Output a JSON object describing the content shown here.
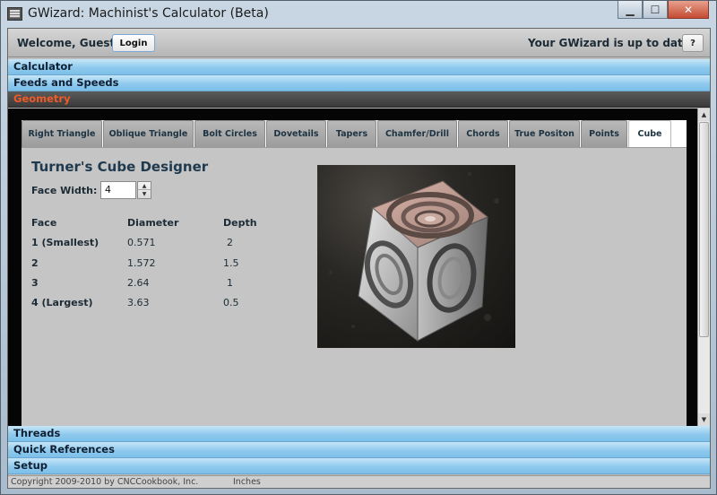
{
  "window": {
    "title": "GWizard: Machinist's Calculator (Beta)",
    "minimize_glyph": "▁",
    "maximize_glyph": "☐",
    "close_glyph": "✕"
  },
  "topbar": {
    "welcome": "Welcome, Guest!",
    "login_label": "Login",
    "status": "Your GWizard is up to date",
    "help_label": "?"
  },
  "sections": {
    "calculator": "Calculator",
    "feeds_speeds": "Feeds and Speeds",
    "geometry": "Geometry",
    "threads": "Threads",
    "quick_references": "Quick References",
    "setup": "Setup"
  },
  "tabs": [
    {
      "label": "Right Triangle",
      "active": false
    },
    {
      "label": "Oblique Triangle",
      "active": false
    },
    {
      "label": "Bolt Circles",
      "active": false
    },
    {
      "label": "Dovetails",
      "active": false
    },
    {
      "label": "Tapers",
      "active": false
    },
    {
      "label": "Chamfer/Drill",
      "active": false
    },
    {
      "label": "Chords",
      "active": false
    },
    {
      "label": "True Positon",
      "active": false
    },
    {
      "label": "Points",
      "active": false
    },
    {
      "label": "Cube",
      "active": true
    }
  ],
  "cube": {
    "title": "Turner's Cube Designer",
    "face_width_label": "Face Width:",
    "face_width_value": "4",
    "columns": [
      "Face",
      "Diameter",
      "Depth"
    ],
    "rows": [
      {
        "face": "1 (Smallest)",
        "diameter": "0.571",
        "depth": "2"
      },
      {
        "face": "2",
        "diameter": "1.572",
        "depth": "1.5"
      },
      {
        "face": "3",
        "diameter": "2.64",
        "depth": "1"
      },
      {
        "face": "4 (Largest)",
        "diameter": "3.63",
        "depth": "0.5"
      }
    ]
  },
  "footer": {
    "copyright": "Copyright 2009-2010 by CNCCookbook, Inc.",
    "units": "Inches"
  },
  "colors": {
    "active_section_text": "#f05a28",
    "section_blue": "#8fcaee",
    "panel_black": "#050505"
  }
}
